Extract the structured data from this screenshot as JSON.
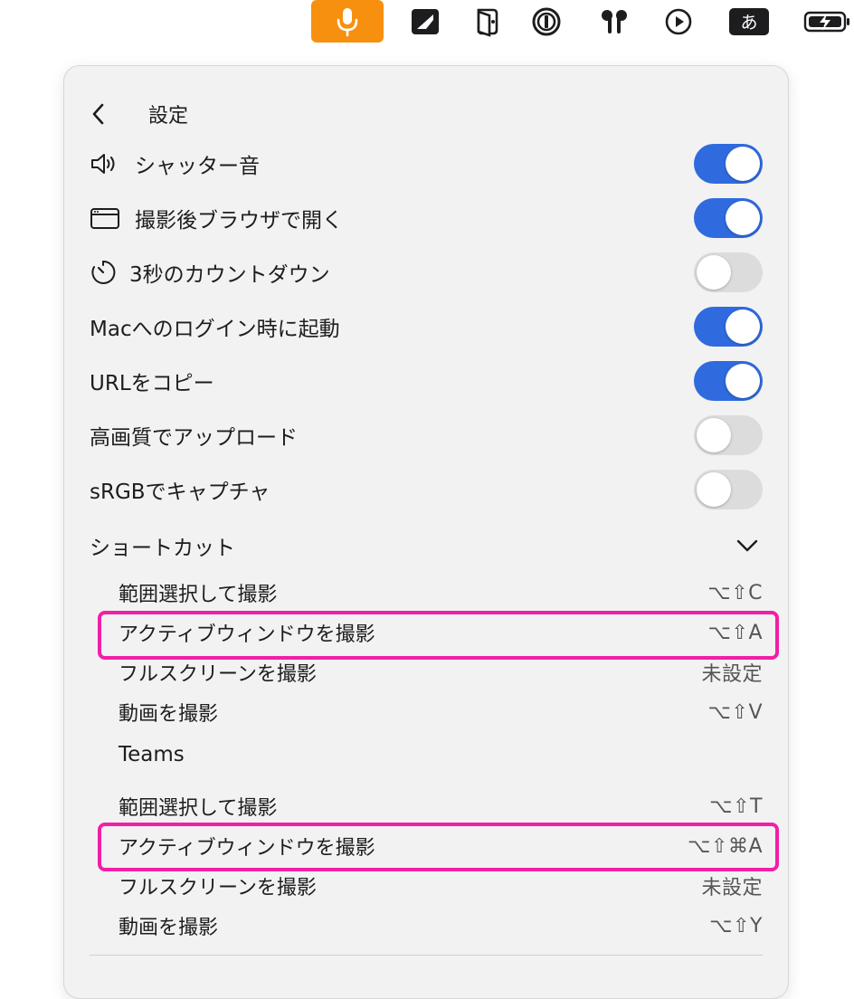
{
  "menubar": {
    "items": [
      {
        "name": "microphone-icon"
      },
      {
        "name": "capture-app-icon"
      },
      {
        "name": "wallet-app-icon"
      },
      {
        "name": "password-manager-icon"
      },
      {
        "name": "airpods-icon"
      },
      {
        "name": "play-icon"
      },
      {
        "name": "input-method-icon",
        "label": "あ"
      },
      {
        "name": "battery-charging-icon"
      }
    ],
    "mic_color": "#f7900f"
  },
  "header": {
    "title": "設定"
  },
  "settings": [
    {
      "label": "シャッター音",
      "icon": "speaker-icon",
      "on": true
    },
    {
      "label": "撮影後ブラウザで開く",
      "icon": "browser-window-icon",
      "on": true
    },
    {
      "label": "3秒のカウントダウン",
      "icon": "timer-icon",
      "on": false
    },
    {
      "label": "Macへのログイン時に起動",
      "icon": "",
      "on": true
    },
    {
      "label": "URLをコピー",
      "icon": "",
      "on": true
    },
    {
      "label": "高画質でアップロード",
      "icon": "",
      "on": false
    },
    {
      "label": "sRGBでキャプチャ",
      "icon": "",
      "on": false
    }
  ],
  "shortcuts": {
    "title": "ショートカット",
    "default": [
      {
        "label": "範囲選択して撮影",
        "key": "⌥⇧C"
      },
      {
        "label": "アクティブウィンドウを撮影",
        "key": "⌥⇧A"
      },
      {
        "label": "フルスクリーンを撮影",
        "key": "未設定"
      },
      {
        "label": "動画を撮影",
        "key": "⌥⇧V"
      }
    ],
    "teams_title": "Teams",
    "teams": [
      {
        "label": "範囲選択して撮影",
        "key": "⌥⇧T"
      },
      {
        "label": "アクティブウィンドウを撮影",
        "key": "⌥⇧⌘A"
      },
      {
        "label": "フルスクリーンを撮影",
        "key": "未設定"
      },
      {
        "label": "動画を撮影",
        "key": "⌥⇧Y"
      }
    ]
  },
  "colors": {
    "toggle_on": "#2f6bde",
    "toggle_off": "#dcdcdc",
    "highlight": "#f21fa8",
    "panel_bg": "#f2f2f2"
  }
}
